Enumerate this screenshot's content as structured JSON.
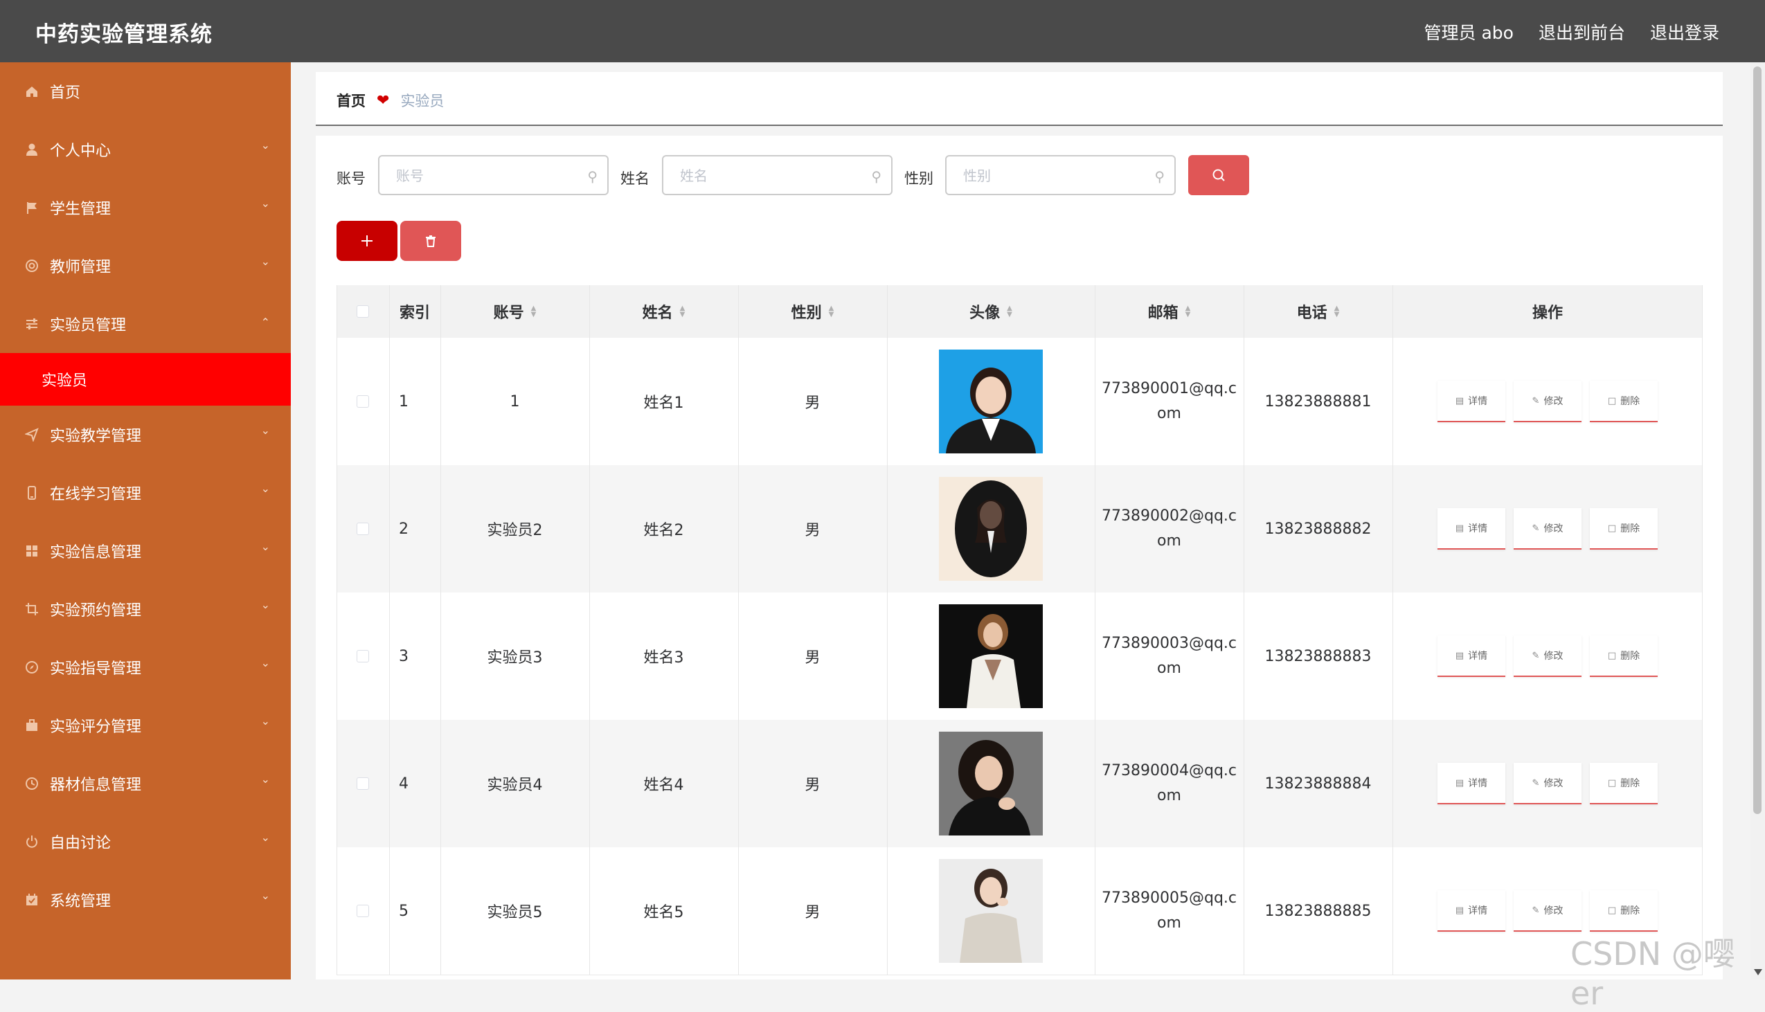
{
  "header": {
    "app_title": "中药实验管理系统",
    "admin_label": "管理员 abo",
    "front_link": "退出到前台",
    "logout_link": "退出登录"
  },
  "sidebar": {
    "items": [
      {
        "label": "首页",
        "icon": "home-icon",
        "expandable": false
      },
      {
        "label": "个人中心",
        "icon": "user-icon",
        "expandable": true
      },
      {
        "label": "学生管理",
        "icon": "flag-icon",
        "expandable": true
      },
      {
        "label": "教师管理",
        "icon": "circle-icon",
        "expandable": true
      },
      {
        "label": "实验员管理",
        "icon": "sliders-icon",
        "expandable": true,
        "expanded": true
      },
      {
        "label": "实验教学管理",
        "icon": "send-icon",
        "expandable": true
      },
      {
        "label": "在线学习管理",
        "icon": "phone-icon",
        "expandable": true
      },
      {
        "label": "实验信息管理",
        "icon": "grid-icon",
        "expandable": true
      },
      {
        "label": "实验预约管理",
        "icon": "crop-icon",
        "expandable": true
      },
      {
        "label": "实验指导管理",
        "icon": "compass-icon",
        "expandable": true
      },
      {
        "label": "实验评分管理",
        "icon": "briefcase-icon",
        "expandable": true
      },
      {
        "label": "器材信息管理",
        "icon": "clock-icon",
        "expandable": true
      },
      {
        "label": "自由讨论",
        "icon": "power-icon",
        "expandable": true
      },
      {
        "label": "系统管理",
        "icon": "calendar-check-icon",
        "expandable": true
      }
    ],
    "active_sub": "实验员"
  },
  "breadcrumb": {
    "home": "首页",
    "current": "实验员"
  },
  "search": {
    "account_label": "账号",
    "account_placeholder": "账号",
    "name_label": "姓名",
    "name_placeholder": "姓名",
    "gender_label": "性别",
    "gender_placeholder": "性别"
  },
  "table": {
    "headers": {
      "index": "索引",
      "account": "账号",
      "name": "姓名",
      "gender": "性别",
      "avatar": "头像",
      "email": "邮箱",
      "phone": "电话",
      "actions": "操作"
    },
    "action_labels": {
      "detail": "详情",
      "edit": "修改",
      "delete": "删除"
    },
    "rows": [
      {
        "index": "1",
        "account": "1",
        "name": "姓名1",
        "gender": "男",
        "email_line1": "773890001@qq.c",
        "email_line2": "om",
        "phone": "13823888881"
      },
      {
        "index": "2",
        "account": "实验员2",
        "name": "姓名2",
        "gender": "男",
        "email_line1": "773890002@qq.c",
        "email_line2": "om",
        "phone": "13823888882"
      },
      {
        "index": "3",
        "account": "实验员3",
        "name": "姓名3",
        "gender": "男",
        "email_line1": "773890003@qq.c",
        "email_line2": "om",
        "phone": "13823888883"
      },
      {
        "index": "4",
        "account": "实验员4",
        "name": "姓名4",
        "gender": "男",
        "email_line1": "773890004@qq.c",
        "email_line2": "om",
        "phone": "13823888884"
      },
      {
        "index": "5",
        "account": "实验员5",
        "name": "姓名5",
        "gender": "男",
        "email_line1": "773890005@qq.c",
        "email_line2": "om",
        "phone": "13823888885"
      }
    ]
  },
  "watermark": "CSDN @嘤er",
  "colors": {
    "topbar": "#4a4a4a",
    "sidebar": "#c6642a",
    "sidebar_active": "#ff0000",
    "primary_button": "#c80000",
    "danger_button": "#e05656"
  }
}
